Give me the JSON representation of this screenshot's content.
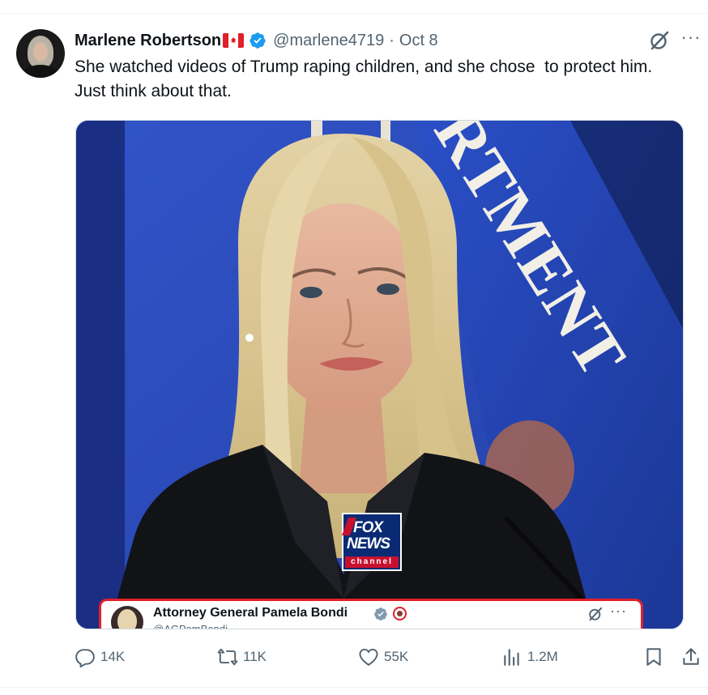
{
  "tweet": {
    "author_name": "Marlene Robertson",
    "author_flag": "canada-flag",
    "handle": "@marlene4719",
    "separator": "·",
    "date": "Oct 8",
    "text": "She watched videos of Trump raping children, and she chose  to protect him.  Just think about that."
  },
  "media": {
    "photo_subject": "woman-speaking-at-podium",
    "backdrop_text": "RTMENT",
    "watermark": {
      "top": "FOX",
      "middle": "NEWS",
      "bottom": "channel"
    },
    "embedded_post": {
      "name": "Attorney General Pamela Bondi",
      "handle": "@AGPamBondi"
    }
  },
  "actions": {
    "reply_count": "14K",
    "repost_count": "11K",
    "like_count": "55K",
    "views_count": "1.2M"
  },
  "colors": {
    "accent": "#1d9bf0",
    "text_secondary": "#536471",
    "backdrop_blue": "#2b4ec9",
    "highlight_red": "#e0202b"
  },
  "icons": [
    "verified-badge-icon",
    "grok-icon",
    "more-icon",
    "reply-icon",
    "repost-icon",
    "like-icon",
    "views-icon",
    "bookmark-icon",
    "share-icon"
  ]
}
